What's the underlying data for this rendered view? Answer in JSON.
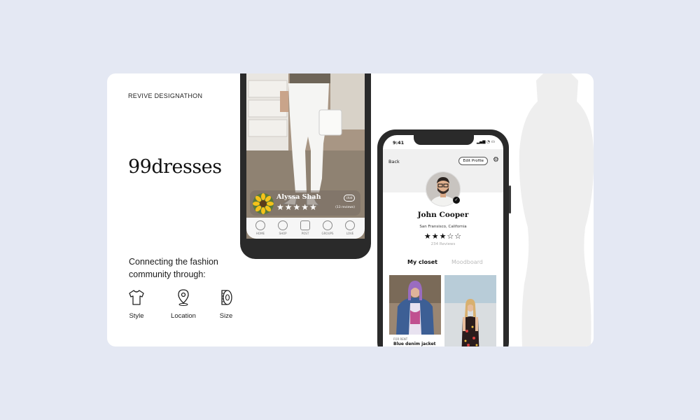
{
  "left_panel": {
    "event_tag": "REVIVE DESIGNATHON",
    "brand": "99dresses",
    "tagline": "Connecting the fashion community through:",
    "features": [
      {
        "label": "Style",
        "icon": "tshirt-icon"
      },
      {
        "label": "Location",
        "icon": "location-pin-icon"
      },
      {
        "label": "Size",
        "icon": "measuring-tape-icon"
      }
    ]
  },
  "phone_feed": {
    "user_name": "Alyssa Shah",
    "rating": 5,
    "stars_text": "★★★★★",
    "reviews": "(13 reviews)",
    "chat_label": "chat",
    "nav": [
      "HOME",
      "SHOP",
      "POST",
      "GROUPS",
      "LOVE"
    ]
  },
  "phone_profile": {
    "time": "9:41",
    "back": "Back",
    "edit_profile": "Edit Profile",
    "name": "John Cooper",
    "location": "San Fransisco, California",
    "rating": 3,
    "stars_text": "★★★☆☆",
    "reviews": "234 Reviews",
    "tabs": [
      "My closet",
      "Moodboard"
    ],
    "item_tag": "FOR RENT",
    "item_name": "Blue denim jacket"
  },
  "colors": {
    "background": "#e4e8f3",
    "card": "#ffffff",
    "phone_frame": "#2a2a2a"
  }
}
